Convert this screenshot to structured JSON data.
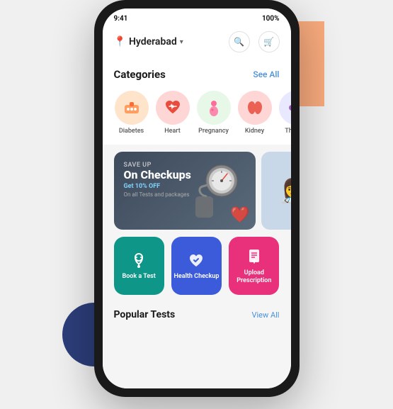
{
  "phone": {
    "location": "Hyderabad",
    "status_bar": {
      "time": "9:41",
      "battery": "100%"
    }
  },
  "header": {
    "location_label": "Hyderabad",
    "chevron": "▾",
    "search_icon": "🔍",
    "cart_icon": "🛒"
  },
  "categories": {
    "title": "Categories",
    "see_all_label": "See All",
    "items": [
      {
        "label": "Diabetes",
        "emoji": "💉",
        "bg": "cat-diabetes"
      },
      {
        "label": "Heart",
        "emoji": "❤️",
        "bg": "cat-heart"
      },
      {
        "label": "Pregnancy",
        "emoji": "🤰",
        "bg": "cat-pregnancy"
      },
      {
        "label": "Kidney",
        "emoji": "🫘",
        "bg": "cat-kidney"
      },
      {
        "label": "Thyroid",
        "emoji": "🦋",
        "bg": "cat-thyroid"
      }
    ]
  },
  "banners": [
    {
      "save_text": "SAVE UP",
      "title": "On Checkups",
      "discount": "Get 10% OFF",
      "subtitle": "On all Tests and packages",
      "type": "dark"
    },
    {
      "type": "image",
      "emoji": "👩‍⚕️"
    }
  ],
  "quick_actions": [
    {
      "label": "Book a\nTest",
      "icon": "🩺",
      "color": "action-btn-teal"
    },
    {
      "label": "Health\nCheckup",
      "icon": "❤️",
      "color": "action-btn-blue"
    },
    {
      "label": "Upload\nPrescription",
      "icon": "📋",
      "color": "action-btn-pink"
    }
  ],
  "popular_tests": {
    "title": "Popular Tests",
    "view_all_label": "View All"
  }
}
